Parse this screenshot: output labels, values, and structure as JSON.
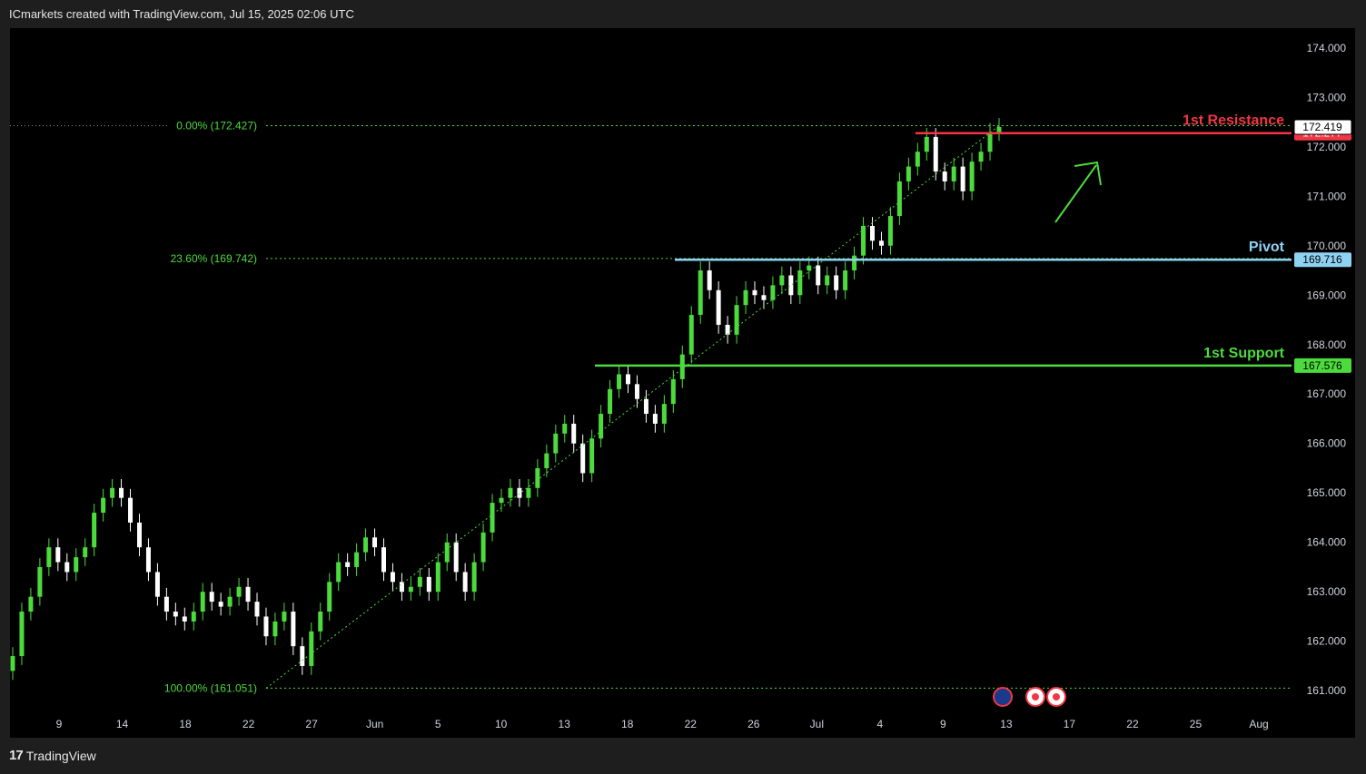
{
  "header": {
    "attribution": "ICmarkets created with TradingView.com, Jul 15, 2025 02:06 UTC"
  },
  "footer": {
    "brand": "TradingView",
    "logo_icon": "tradingview-logo-icon"
  },
  "colors": {
    "up": "#4cdb3c",
    "down": "#ffffff",
    "resistance": "#f23645",
    "pivot": "#8fd3f4",
    "support": "#4cdb3c",
    "fib": "#4cdb3c",
    "arrow": "#4cdb3c",
    "axis_text": "#d1d4dc"
  },
  "chart_data": {
    "type": "candlestick",
    "y_axis": {
      "ticks": [
        "174.000",
        "173.000",
        "172.000",
        "171.000",
        "170.000",
        "169.000",
        "168.000",
        "167.000",
        "166.000",
        "165.000",
        "164.000",
        "163.000",
        "162.000",
        "161.000"
      ],
      "ylim": [
        160.6,
        174.4
      ]
    },
    "x_axis": {
      "ticks": [
        "9",
        "14",
        "18",
        "22",
        "27",
        "Jun",
        "5",
        "10",
        "13",
        "18",
        "22",
        "26",
        "Jul",
        "4",
        "9",
        "13",
        "17",
        "22",
        "25",
        "Aug"
      ]
    },
    "levels": [
      {
        "label": "1st Resistance",
        "value": 172.277,
        "price_label": "172.277",
        "color": "#f23645"
      },
      {
        "label": "Pivot",
        "value": 169.716,
        "price_label": "169.716",
        "color": "#8fd3f4"
      },
      {
        "label": "1st Support",
        "value": 167.576,
        "price_label": "167.576",
        "color": "#4cdb3c"
      }
    ],
    "current_price": {
      "value": 172.419,
      "price_label": "172.419"
    },
    "fib_levels": [
      {
        "label": "0.00% (172.427)",
        "value": 172.427
      },
      {
        "label": "23.60% (169.742)",
        "value": 169.742
      },
      {
        "label": "100.00% (161.051)",
        "value": 161.051
      }
    ],
    "candle_closes": [
      161.7,
      162.6,
      162.9,
      163.5,
      163.9,
      163.6,
      163.4,
      163.7,
      163.9,
      164.6,
      164.9,
      165.1,
      164.9,
      164.4,
      163.9,
      163.4,
      162.9,
      162.6,
      162.5,
      162.4,
      162.6,
      163.0,
      162.8,
      162.7,
      162.9,
      163.1,
      162.8,
      162.5,
      162.1,
      162.4,
      162.6,
      161.9,
      161.5,
      162.2,
      162.6,
      163.2,
      163.6,
      163.5,
      163.8,
      164.1,
      163.9,
      163.4,
      163.2,
      163.0,
      163.1,
      163.3,
      163.0,
      163.6,
      164.0,
      163.4,
      163.0,
      163.6,
      164.2,
      164.8,
      164.9,
      165.1,
      164.9,
      165.1,
      165.5,
      165.8,
      166.2,
      166.4,
      166.0,
      165.4,
      166.1,
      166.6,
      167.1,
      167.4,
      167.2,
      166.9,
      166.6,
      166.4,
      166.8,
      167.3,
      167.8,
      168.6,
      169.5,
      169.1,
      168.4,
      168.2,
      168.8,
      169.1,
      169.0,
      168.9,
      169.2,
      169.4,
      169.0,
      169.5,
      169.6,
      169.2,
      169.4,
      169.1,
      169.5,
      169.8,
      170.4,
      170.1,
      170.0,
      170.6,
      171.3,
      171.6,
      171.9,
      172.2,
      171.5,
      171.3,
      171.6,
      171.1,
      171.7,
      171.9,
      172.3,
      172.4
    ],
    "annotation_arrow": {
      "direction": "up"
    }
  }
}
